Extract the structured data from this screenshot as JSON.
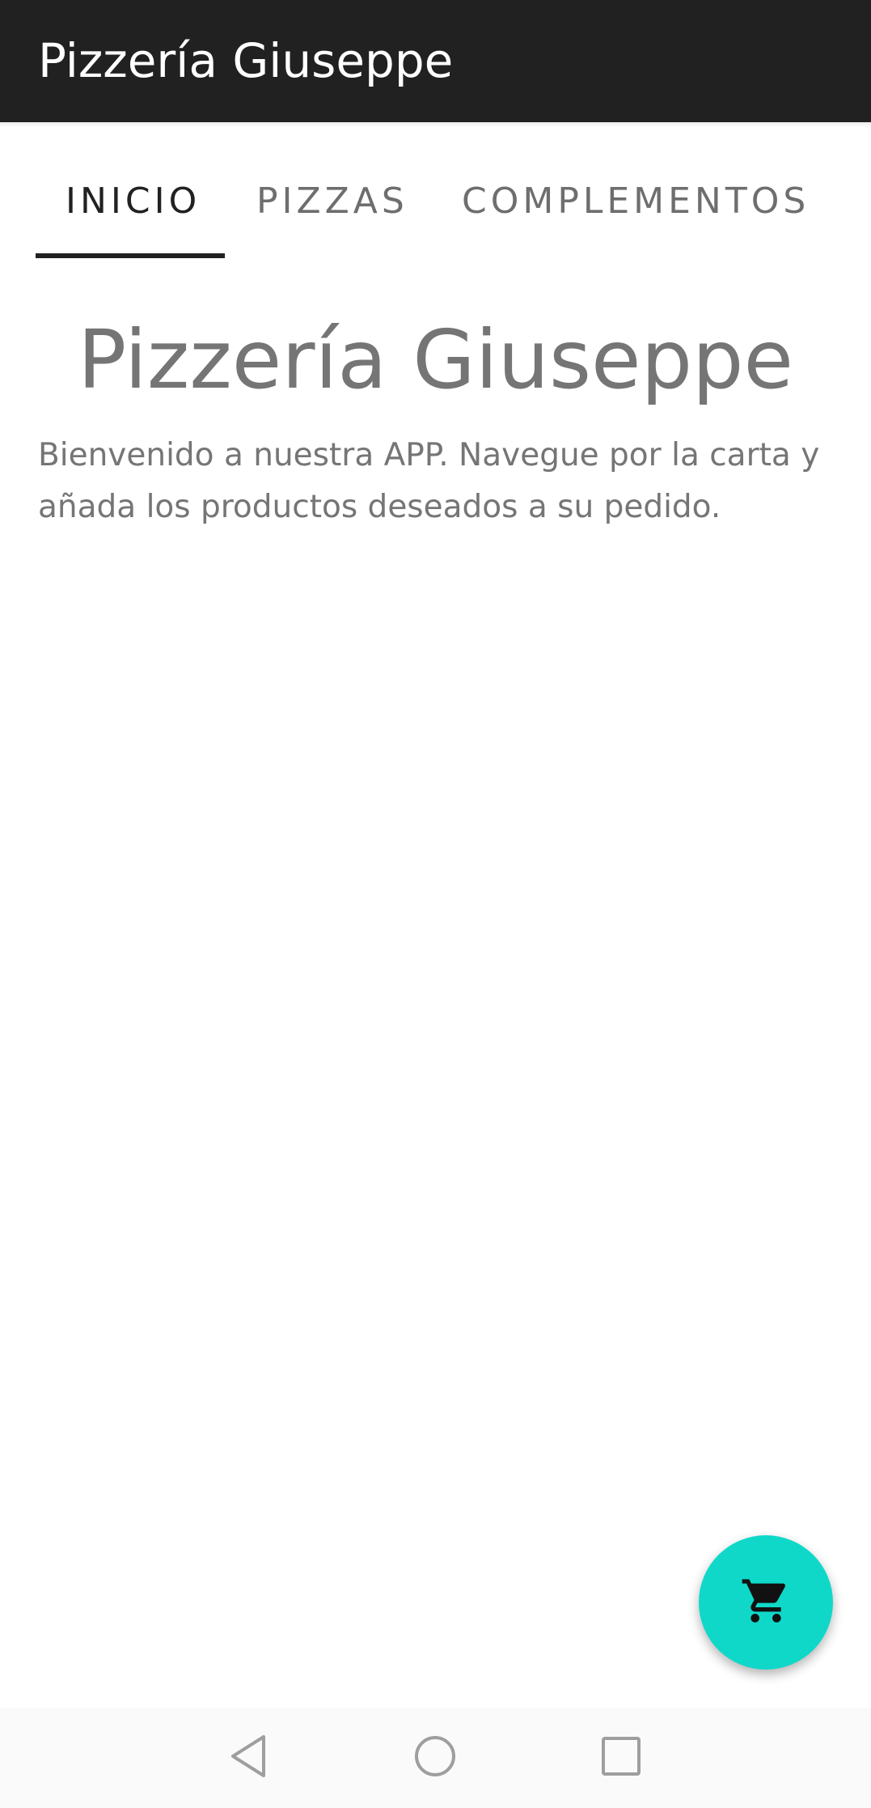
{
  "app_bar": {
    "title": "Pizzería Giuseppe",
    "background_color": "#212121"
  },
  "tabs": [
    {
      "label": "INICIO",
      "active": true
    },
    {
      "label": "PIZZAS",
      "active": false
    },
    {
      "label": "COMPLEMENTOS",
      "active": false
    }
  ],
  "content": {
    "title": "Pizzería Giuseppe",
    "text": "Bienvenido a nuestra APP. Navegue por la carta y añada los productos deseados a su pedido."
  },
  "fab": {
    "icon": "cart-icon",
    "color": "#0fd8c9"
  },
  "nav_bar": {
    "back_icon": "back-triangle-icon",
    "home_icon": "home-circle-icon",
    "recents_icon": "recents-square-icon"
  }
}
